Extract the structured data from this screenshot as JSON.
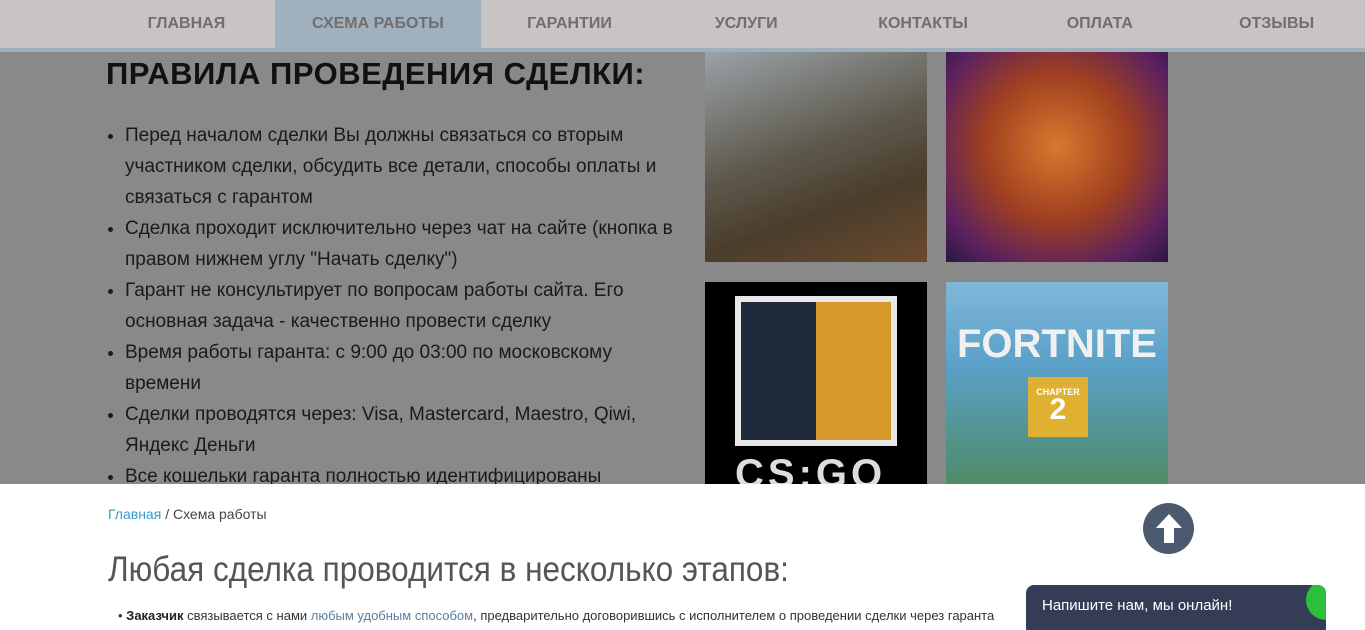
{
  "nav": {
    "items": [
      "ГЛАВНАЯ",
      "СХЕМА РАБОТЫ",
      "ГАРАНТИИ",
      "УСЛУГИ",
      "КОНТАКТЫ",
      "ОПЛАТА",
      "ОТЗЫВЫ"
    ],
    "active": 1
  },
  "rules": {
    "title": "ПРАВИЛА ПРОВЕДЕНИЯ СДЕЛКИ:",
    "items": [
      "Перед началом сделки Вы должны связаться со вторым участником сделки, обсудить все детали, способы оплаты и связаться с гарантом",
      "Сделка проходит исключительно через чат на сайте (кнопка в правом нижнем углу \"Начать сделку\")",
      "Гарант не консультирует по вопросам работы сайта. Его основная задача - качественно провести сделку",
      "Время работы гаранта: с 9:00 до 03:00 по московскому времени",
      "Сделки проводятся через: Visa, Mastercard, Maestro, Qiwi, Яндекс Деньги",
      "Все кошельки гаранта полностью идентифицированы"
    ]
  },
  "games": {
    "csgo_logo": "CS:GO",
    "fortnite_logo": "FORTNITE",
    "fortnite_chapter": "CHAPTER",
    "fortnite_number": "2"
  },
  "breadcrumb": {
    "home": "Главная",
    "sep": "/",
    "current": "Схема работы"
  },
  "main": {
    "heading": "Любая сделка проводится в несколько этапов:",
    "step1_bold": "Заказчик",
    "step1_a": " связывается с нами ",
    "step1_link": "любым удобным способом",
    "step1_b": ", предварительно договорившись с исполнителем о проведении сделки через гаранта"
  },
  "chat": {
    "label": "Напишите нам, мы онлайн!"
  }
}
